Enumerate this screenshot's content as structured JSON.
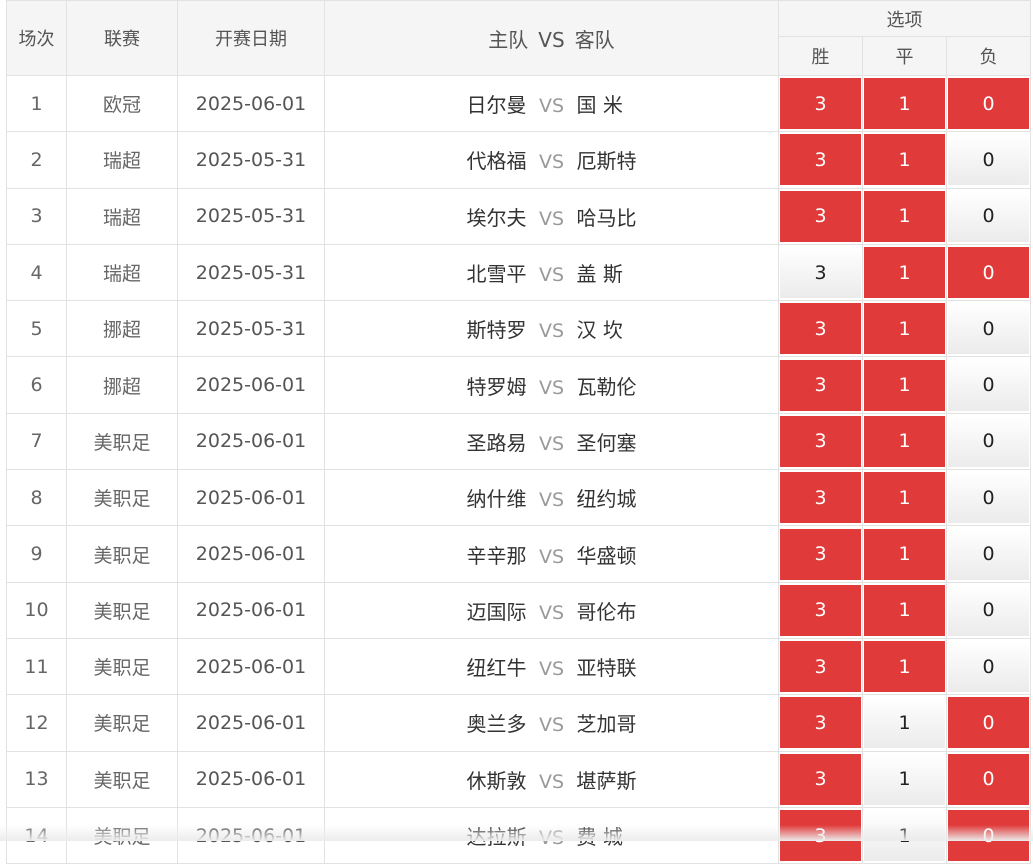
{
  "header": {
    "round": "场次",
    "league": "联赛",
    "date": "开赛日期",
    "home": "主队",
    "vs": "VS",
    "away": "客队",
    "options": "选项",
    "win": "胜",
    "draw": "平",
    "lose": "负"
  },
  "colors": {
    "selected": "#e03a3a",
    "border": "#e2e2e2",
    "header_bg": "#f5f5f5"
  },
  "rows": [
    {
      "idx": "1",
      "league": "欧冠",
      "date": "2025-06-01",
      "home": "日尔曼",
      "vs": "VS",
      "away": "国 米",
      "win": "3",
      "draw": "1",
      "lose": "0",
      "win_sel": true,
      "draw_sel": true,
      "lose_sel": true
    },
    {
      "idx": "2",
      "league": "瑞超",
      "date": "2025-05-31",
      "home": "代格福",
      "vs": "VS",
      "away": "厄斯特",
      "win": "3",
      "draw": "1",
      "lose": "0",
      "win_sel": true,
      "draw_sel": true,
      "lose_sel": false
    },
    {
      "idx": "3",
      "league": "瑞超",
      "date": "2025-05-31",
      "home": "埃尔夫",
      "vs": "VS",
      "away": "哈马比",
      "win": "3",
      "draw": "1",
      "lose": "0",
      "win_sel": true,
      "draw_sel": true,
      "lose_sel": false
    },
    {
      "idx": "4",
      "league": "瑞超",
      "date": "2025-05-31",
      "home": "北雪平",
      "vs": "VS",
      "away": "盖 斯",
      "win": "3",
      "draw": "1",
      "lose": "0",
      "win_sel": false,
      "draw_sel": true,
      "lose_sel": true
    },
    {
      "idx": "5",
      "league": "挪超",
      "date": "2025-05-31",
      "home": "斯特罗",
      "vs": "VS",
      "away": "汉 坎",
      "win": "3",
      "draw": "1",
      "lose": "0",
      "win_sel": true,
      "draw_sel": true,
      "lose_sel": false
    },
    {
      "idx": "6",
      "league": "挪超",
      "date": "2025-06-01",
      "home": "特罗姆",
      "vs": "VS",
      "away": "瓦勒伦",
      "win": "3",
      "draw": "1",
      "lose": "0",
      "win_sel": true,
      "draw_sel": true,
      "lose_sel": false
    },
    {
      "idx": "7",
      "league": "美职足",
      "date": "2025-06-01",
      "home": "圣路易",
      "vs": "VS",
      "away": "圣何塞",
      "win": "3",
      "draw": "1",
      "lose": "0",
      "win_sel": true,
      "draw_sel": true,
      "lose_sel": false
    },
    {
      "idx": "8",
      "league": "美职足",
      "date": "2025-06-01",
      "home": "纳什维",
      "vs": "VS",
      "away": "纽约城",
      "win": "3",
      "draw": "1",
      "lose": "0",
      "win_sel": true,
      "draw_sel": true,
      "lose_sel": false
    },
    {
      "idx": "9",
      "league": "美职足",
      "date": "2025-06-01",
      "home": "辛辛那",
      "vs": "VS",
      "away": "华盛顿",
      "win": "3",
      "draw": "1",
      "lose": "0",
      "win_sel": true,
      "draw_sel": true,
      "lose_sel": false
    },
    {
      "idx": "10",
      "league": "美职足",
      "date": "2025-06-01",
      "home": "迈国际",
      "vs": "VS",
      "away": "哥伦布",
      "win": "3",
      "draw": "1",
      "lose": "0",
      "win_sel": true,
      "draw_sel": true,
      "lose_sel": false
    },
    {
      "idx": "11",
      "league": "美职足",
      "date": "2025-06-01",
      "home": "纽红牛",
      "vs": "VS",
      "away": "亚特联",
      "win": "3",
      "draw": "1",
      "lose": "0",
      "win_sel": true,
      "draw_sel": true,
      "lose_sel": false
    },
    {
      "idx": "12",
      "league": "美职足",
      "date": "2025-06-01",
      "home": "奥兰多",
      "vs": "VS",
      "away": "芝加哥",
      "win": "3",
      "draw": "1",
      "lose": "0",
      "win_sel": true,
      "draw_sel": false,
      "lose_sel": true
    },
    {
      "idx": "13",
      "league": "美职足",
      "date": "2025-06-01",
      "home": "休斯敦",
      "vs": "VS",
      "away": "堪萨斯",
      "win": "3",
      "draw": "1",
      "lose": "0",
      "win_sel": true,
      "draw_sel": false,
      "lose_sel": true
    },
    {
      "idx": "14",
      "league": "美职足",
      "date": "2025-06-01",
      "home": "达拉斯",
      "vs": "VS",
      "away": "费 城",
      "win": "3",
      "draw": "1",
      "lose": "0",
      "win_sel": true,
      "draw_sel": false,
      "lose_sel": true
    }
  ]
}
